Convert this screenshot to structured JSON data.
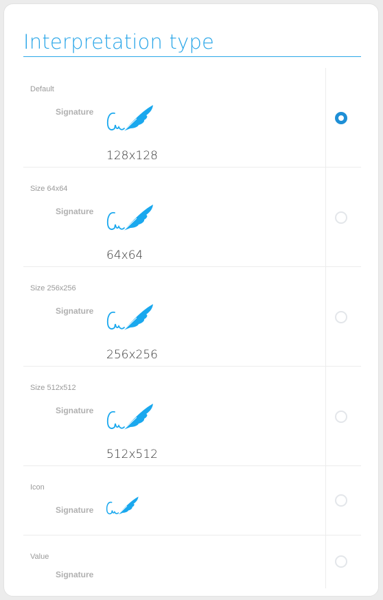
{
  "title": "Interpretation type",
  "field_label": "Signature",
  "accent_color": "#2aa6e8",
  "icon": "signature-quill-icon",
  "options": [
    {
      "label": "Default",
      "size_text": "128x128",
      "selected": true
    },
    {
      "label": "Size 64x64",
      "size_text": "64x64",
      "selected": false
    },
    {
      "label": "Size 256x256",
      "size_text": "256x256",
      "selected": false
    },
    {
      "label": "Size 512x512",
      "size_text": "512x512",
      "selected": false
    },
    {
      "label": "Icon",
      "size_text": "",
      "selected": false
    },
    {
      "label": "Value",
      "size_text": "",
      "selected": false
    }
  ]
}
